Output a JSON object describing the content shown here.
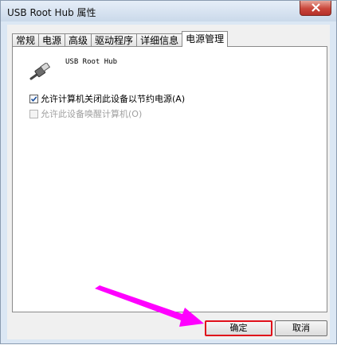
{
  "window": {
    "title": "USB Root Hub 属性"
  },
  "tabs": [
    {
      "label": "常规"
    },
    {
      "label": "电源"
    },
    {
      "label": "高级"
    },
    {
      "label": "驱动程序"
    },
    {
      "label": "详细信息"
    },
    {
      "label": "电源管理",
      "active": true
    }
  ],
  "device": {
    "name": "USB Root Hub",
    "icon": "usb-plug-icon"
  },
  "options": {
    "allow_turn_off": {
      "label": "允许计算机关闭此设备以节约电源(A)",
      "checked": true,
      "enabled": true
    },
    "allow_wake": {
      "label": "允许此设备唤醒计算机(O)",
      "checked": false,
      "enabled": false
    }
  },
  "buttons": {
    "ok": "确定",
    "cancel": "取消"
  },
  "colors": {
    "highlight": "#e0101a",
    "arrow": "#ff00ff"
  }
}
